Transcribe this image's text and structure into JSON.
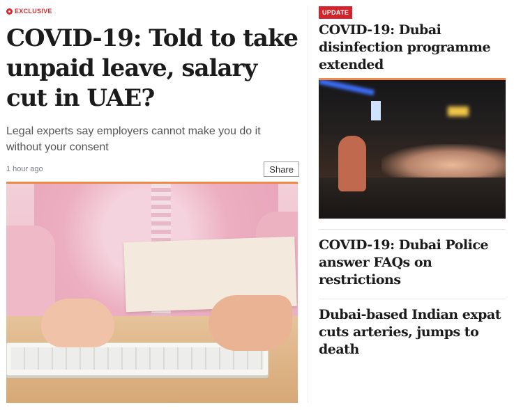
{
  "left": {
    "tag": "EXCLUSIVE",
    "headline": "COVID-19: Told to take unpaid leave, salary cut in UAE?",
    "subhead": "Legal experts say employers cannot make you do it without your consent",
    "time": "1 hour ago",
    "share_label": "Share"
  },
  "right": {
    "badge": "UPDATE",
    "stories": [
      {
        "title": "COVID-19: Dubai disinfection programme extended"
      },
      {
        "title": "COVID-19: Dubai Police answer FAQs on restrictions"
      },
      {
        "title": "Dubai-based Indian expat cuts arteries, jumps to death"
      }
    ]
  },
  "colors": {
    "accent_red": "#d3242b",
    "orange_rule": "#f08a4b"
  }
}
